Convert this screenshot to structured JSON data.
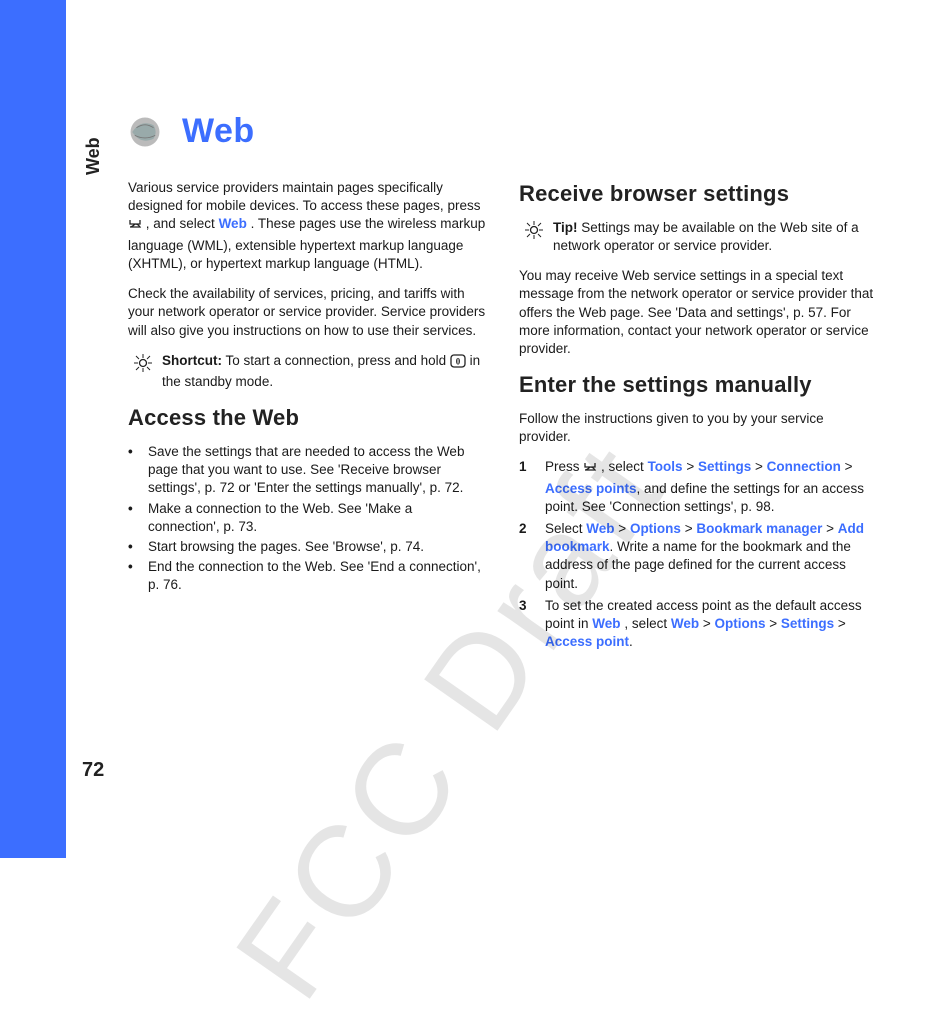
{
  "sidebarLabel": "Web",
  "pageNumber": "72",
  "watermark": "FCC Draft",
  "title": "Web",
  "col1": {
    "intro1a": "Various service providers maintain pages specifically designed for mobile devices. To access these pages, press ",
    "intro1b": ", and select ",
    "intro1Link": "Web",
    "intro1c": ". These pages use the wireless markup language (WML), extensible hypertext markup language (XHTML), or hypertext markup language (HTML).",
    "intro2": "Check the availability of services, pricing, and tariffs with your network operator or service provider. Service providers will also give you instructions on how to use their services.",
    "shortcutLabel": "Shortcut:",
    "shortcutText": " To start a connection, press and hold ",
    "shortcutKey": "0",
    "shortcutTail": " in the standby mode.",
    "h1": "Access the Web",
    "bullets": [
      "Save the settings that are needed to access the Web page that you want to use. See 'Receive browser settings', p. 72 or 'Enter the settings manually', p. 72.",
      "Make a connection to the Web. See 'Make a connection', p. 73.",
      "Start browsing the pages. See 'Browse', p. 74.",
      "End the connection to the Web. See 'End a connection', p. 76."
    ]
  },
  "col2": {
    "h1": "Receive browser settings",
    "tipLabel": "Tip!",
    "tipText": " Settings may be available on the Web site of a network operator or service provider.",
    "p1": "You may receive Web service settings in a special text message from the network operator or service provider that offers the Web page. See 'Data and settings', p. 57. For more information, contact your network operator or service provider.",
    "h2": "Enter the settings manually",
    "p2": "Follow the instructions given to you by your service provider.",
    "step1a": "Press ",
    "step1b": ", select ",
    "step1Links": {
      "tools": "Tools",
      "settings": "Settings",
      "connection": "Connection",
      "accessPoints": "Access points"
    },
    "step1c": ", and define the settings for an access point. See 'Connection settings', p. 98.",
    "step2a": "Select ",
    "step2Links": {
      "web": "Web",
      "options": "Options",
      "bookmarkMgr": "Bookmark manager",
      "addBookmark": "Add bookmark"
    },
    "step2b": ". Write a name for the bookmark and the address of the page defined for the current access point.",
    "step3a": "To set the created access point as the default access point in ",
    "step3LinkWeb": "Web",
    "step3b": ", select ",
    "step3Links": {
      "web": "Web",
      "options": "Options",
      "settings": "Settings",
      "accessPoint": "Access point"
    },
    "step3c": ".",
    "numbers": [
      "1",
      "2",
      "3"
    ],
    "gt": " > "
  }
}
